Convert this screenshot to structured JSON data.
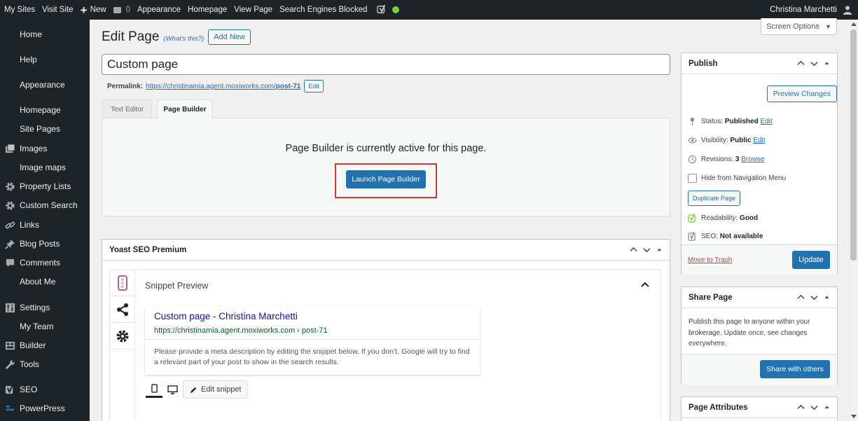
{
  "adminbar": {
    "my_sites": "My Sites",
    "visit_site": "Visit Site",
    "new": "New",
    "comments_count": "0",
    "appearance": "Appearance",
    "homepage": "Homepage",
    "view_page": "View Page",
    "search_engines_blocked": "Search Engines Blocked",
    "user_name": "Christina Marchetti",
    "status_dot_color": "#7ad03a"
  },
  "sidebar": {
    "items": [
      {
        "label": "Home",
        "icon": "none"
      },
      {
        "label": "Help",
        "icon": "none"
      },
      {
        "label": "Appearance",
        "icon": "none"
      },
      {
        "label": "Homepage",
        "icon": "none"
      },
      {
        "label": "Site Pages",
        "icon": "none"
      },
      {
        "label": "Images",
        "icon": "images-icon"
      },
      {
        "label": "Image maps",
        "icon": "none"
      },
      {
        "label": "Property Lists",
        "icon": "gear-icon"
      },
      {
        "label": "Custom Search",
        "icon": "gear-icon"
      },
      {
        "label": "Links",
        "icon": "link-icon"
      },
      {
        "label": "Blog Posts",
        "icon": "pin-icon"
      },
      {
        "label": "Comments",
        "icon": "comment-icon"
      },
      {
        "label": "About Me",
        "icon": "none"
      },
      {
        "label": "Settings",
        "icon": "settings-icon"
      },
      {
        "label": "My Team",
        "icon": "none"
      },
      {
        "label": "Builder",
        "icon": "builder-icon"
      },
      {
        "label": "Tools",
        "icon": "wrench-icon"
      },
      {
        "label": "SEO",
        "icon": "yoast-icon"
      },
      {
        "label": "PowerPress",
        "icon": "powerpress-icon"
      }
    ]
  },
  "screen_options": "Screen Options",
  "heading": {
    "title": "Edit Page",
    "whats_this": "(What's this?)",
    "add_new": "Add New"
  },
  "title_value": "Custom page",
  "permalink": {
    "label": "Permalink:",
    "url_base": "https://christinamia.agent.moxiworks.com/",
    "url_slug": "post-71",
    "edit": "Edit"
  },
  "editor_tabs": {
    "text_editor": "Text Editor",
    "page_builder": "Page Builder"
  },
  "page_builder": {
    "message": "Page Builder is currently active for this page.",
    "launch": "Launch Page Builder",
    "highlight_color": "#d63638"
  },
  "yoast": {
    "title": "Yoast SEO Premium",
    "snippet_label": "Snippet Preview",
    "snippet_title": "Custom page - Christina Marchetti",
    "snippet_url": "https://christinamia.agent.moxiworks.com › post-71",
    "snippet_desc": "Please provide a meta description by editing the snippet below. If you don’t, Google will try to find a relevant part of your post to show in the search results.",
    "edit_snippet": "Edit snippet"
  },
  "publish": {
    "title": "Publish",
    "preview": "Preview Changes",
    "status_label": "Status:",
    "status_value": "Published",
    "visibility_label": "Visibility:",
    "visibility_value": "Public",
    "revisions_label": "Revisions:",
    "revisions_value": "3",
    "browse": "Browse",
    "edit": "Edit",
    "hide_nav": "Hide from Navigation Menu",
    "duplicate": "Duplicate Page",
    "readability_label": "Readability:",
    "readability_value": "Good",
    "seo_label": "SEO:",
    "seo_value": "Not available",
    "trash": "Move to Trash",
    "update": "Update"
  },
  "share": {
    "title": "Share Page",
    "text": "Publish this page to anyone within your brokerage. Update once, see changes everywhere.",
    "button": "Share with others"
  },
  "attributes": {
    "title": "Page Attributes"
  },
  "colors": {
    "primary": "#2271b1",
    "admin_dark": "#1d2327",
    "readability_good": "#7ad03a"
  }
}
